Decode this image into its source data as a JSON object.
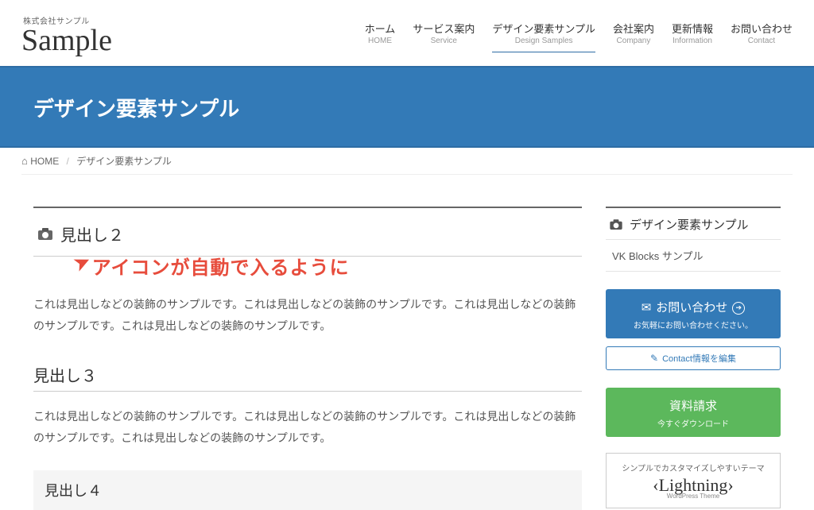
{
  "header": {
    "tagline": "株式会社サンプル",
    "logo": "Sample",
    "nav": [
      {
        "ja": "ホーム",
        "en": "HOME"
      },
      {
        "ja": "サービス案内",
        "en": "Service"
      },
      {
        "ja": "デザイン要素サンプル",
        "en": "Design Samples"
      },
      {
        "ja": "会社案内",
        "en": "Company"
      },
      {
        "ja": "更新情報",
        "en": "Information"
      },
      {
        "ja": "お問い合わせ",
        "en": "Contact"
      }
    ],
    "active_index": 2
  },
  "hero": {
    "title": "デザイン要素サンプル"
  },
  "breadcrumb": {
    "home": "HOME",
    "current": "デザイン要素サンプル"
  },
  "content": {
    "h2": "見出し２",
    "annotation": "アイコンが自動で入るように",
    "p1": "これは見出しなどの装飾のサンプルです。これは見出しなどの装飾のサンプルです。これは見出しなどの装飾のサンプルです。これは見出しなどの装飾のサンプルです。",
    "h3": "見出し３",
    "p2": "これは見出しなどの装飾のサンプルです。これは見出しなどの装飾のサンプルです。これは見出しなどの装飾のサンプルです。これは見出しなどの装飾のサンプルです。",
    "h4": "見出し４"
  },
  "sidebar": {
    "heading": "デザイン要素サンプル",
    "list_item": "VK Blocks サンプル",
    "contact": {
      "main": "お問い合わせ",
      "sub": "お気軽にお問い合わせください。"
    },
    "edit": "Contact情報を編集",
    "download": {
      "main": "資料請求",
      "sub": "今すぐダウンロード"
    },
    "banner": {
      "tag": "シンプルでカスタマイズしやすいテーマ",
      "title": "Lightning",
      "sub": "WordPress Theme"
    }
  }
}
